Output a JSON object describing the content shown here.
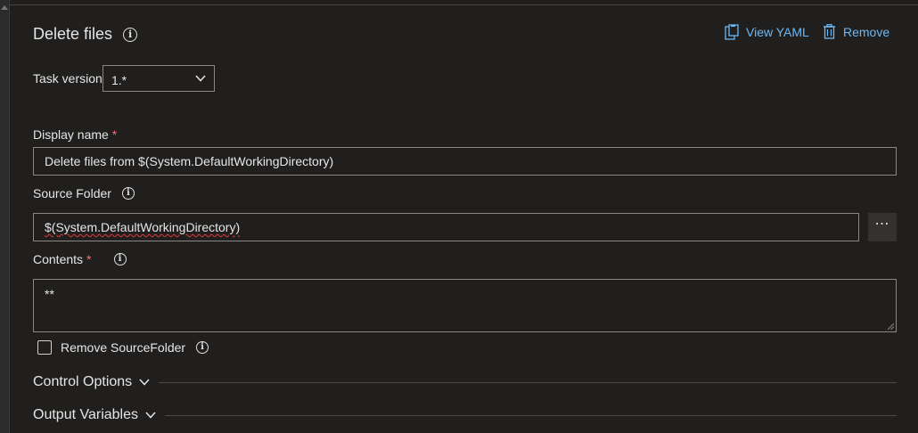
{
  "task": {
    "title": "Delete files",
    "actions": {
      "view_yaml": "View YAML",
      "remove": "Remove"
    },
    "version": {
      "label": "Task version",
      "value": "1.*"
    }
  },
  "fields": {
    "display_name": {
      "label": "Display name",
      "required_mark": "*",
      "value": "Delete files from $(System.DefaultWorkingDirectory)"
    },
    "source_folder": {
      "label": "Source Folder",
      "value": "$(System.DefaultWorkingDirectory)",
      "browse_label": "⋯"
    },
    "contents": {
      "label": "Contents",
      "required_mark": "*",
      "value": "**"
    },
    "remove_source_folder": {
      "label": "Remove SourceFolder",
      "checked": false
    }
  },
  "sections": {
    "control_options": "Control Options",
    "output_variables": "Output Variables"
  },
  "colors": {
    "accent": "#6cb8f6",
    "required": "#f1707b",
    "background": "#201f1e"
  }
}
